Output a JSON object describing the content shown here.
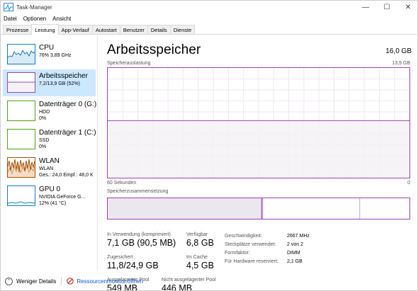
{
  "window": {
    "title": "Task-Manager",
    "minimize": "—",
    "maximize": "☐",
    "close": "✕"
  },
  "menu": [
    "Datei",
    "Optionen",
    "Ansicht"
  ],
  "tabs": [
    {
      "label": "Prozesse",
      "active": false
    },
    {
      "label": "Leistung",
      "active": true
    },
    {
      "label": "App-Verlauf",
      "active": false
    },
    {
      "label": "Autostart",
      "active": false
    },
    {
      "label": "Benutzer",
      "active": false
    },
    {
      "label": "Details",
      "active": false
    },
    {
      "label": "Dienste",
      "active": false
    }
  ],
  "sidebar": [
    {
      "name": "CPU",
      "sub1": "76%  3,89 GHz",
      "sub2": "",
      "color": "#117dbb"
    },
    {
      "name": "Arbeitsspeicher",
      "sub1": "7,2/13,9 GB (52%)",
      "sub2": "",
      "color": "#9b43b3"
    },
    {
      "name": "Datenträger 0 (G:)",
      "sub1": "HDD",
      "sub2": "0%",
      "color": "#4da60c"
    },
    {
      "name": "Datenträger 1 (C:)",
      "sub1": "SSD",
      "sub2": "0%",
      "color": "#4da60c"
    },
    {
      "name": "WLAN",
      "sub1": "WLAN",
      "sub2": "Ges.: 24,0  Empf.: 48,0 K",
      "color": "#a74f01"
    },
    {
      "name": "GPU 0",
      "sub1": "NVIDIA GeForce G...",
      "sub2": "12%  (41 °C)",
      "color": "#117dbb"
    }
  ],
  "main": {
    "title": "Arbeitsspeicher",
    "total": "16,0 GB",
    "usage_label": "Speicherauslastung",
    "usage_max": "13,9 GB",
    "time_left": "60 Sekunden",
    "time_right": "0",
    "composition_label": "Speicherzusammensetzung",
    "usage_fraction": 0.52,
    "composition": {
      "in_use_fraction": 0.51,
      "modified_fraction": 0.005,
      "standby_fraction": 0.32
    }
  },
  "stats": {
    "in_use_label": "In Verwendung (komprimiert)",
    "in_use_value": "7,1 GB (90,5 MB)",
    "available_label": "Verfügbar",
    "available_value": "6,8 GB",
    "committed_label": "Zugesichert",
    "committed_value": "11,8/24,9 GB",
    "cached_label": "Im Cache",
    "cached_value": "4,5 GB",
    "paged_label": "Ausgelagerter Pool",
    "paged_value": "549 MB",
    "nonpaged_label": "Nicht ausgelagerter Pool",
    "nonpaged_value": "446 MB"
  },
  "specs": [
    {
      "key": "Geschwindigkeit:",
      "value": "2667 MHz"
    },
    {
      "key": "Steckplätze verwendet:",
      "value": "2 von 2"
    },
    {
      "key": "Formfaktor:",
      "value": "DIMM"
    },
    {
      "key": "Für Hardware reserviert:",
      "value": "2,1 GB"
    }
  ],
  "footer": {
    "fewer_details": "Weniger Details",
    "resource_monitor": "Ressourcenmonitor öffnen"
  },
  "colors": {
    "memory": "#9b43b3",
    "memory_fill": "#f4f2f4",
    "grid": "#efe6f2",
    "accent": "#cce8ff"
  }
}
